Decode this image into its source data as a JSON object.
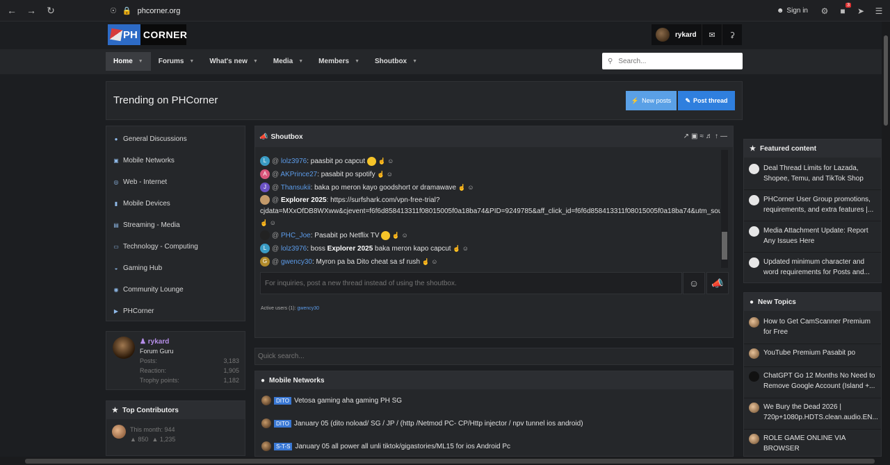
{
  "browser": {
    "url": "phcorner.org",
    "signin_label": "Sign in",
    "ext_badge": "3"
  },
  "header": {
    "logo_ph": "PH",
    "logo_corner": "CORNER",
    "username": "rykard"
  },
  "nav": {
    "items": [
      {
        "label": "Home",
        "active": true
      },
      {
        "label": "Forums"
      },
      {
        "label": "What's new"
      },
      {
        "label": "Media"
      },
      {
        "label": "Members"
      },
      {
        "label": "Shoutbox"
      }
    ],
    "search_placeholder": "Search..."
  },
  "trending": {
    "title": "Trending on PHCorner",
    "new_posts": "New posts",
    "post_thread": "Post thread"
  },
  "categories": [
    {
      "label": "General Discussions",
      "icon": "globe-icon"
    },
    {
      "label": "Mobile Networks",
      "icon": "signal-icon"
    },
    {
      "label": "Web - Internet",
      "icon": "web-icon"
    },
    {
      "label": "Mobile Devices",
      "icon": "phone-icon"
    },
    {
      "label": "Streaming - Media",
      "icon": "film-icon"
    },
    {
      "label": "Technology - Computing",
      "icon": "laptop-icon"
    },
    {
      "label": "Gaming Hub",
      "icon": "gamepad-icon"
    },
    {
      "label": "Community Lounge",
      "icon": "people-icon"
    },
    {
      "label": "PHCorner",
      "icon": "flag-icon"
    }
  ],
  "profile": {
    "name": "rykard",
    "title": "Forum Guru",
    "stats": [
      {
        "label": "Posts:",
        "value": "3,183"
      },
      {
        "label": "Reaction:",
        "value": "1,905"
      },
      {
        "label": "Trophy points:",
        "value": "1,182"
      }
    ]
  },
  "contributors": {
    "title": "Top Contributors",
    "line1": "This month: 944",
    "line2a": "850",
    "line2b": "1,235"
  },
  "shoutbox": {
    "title": "Shoutbox",
    "messages": [
      {
        "avatar": "L",
        "color": "#3a9bc4",
        "user": "lolz3976",
        "text": ": paasbit po capcut",
        "emoji": true
      },
      {
        "avatar": "A",
        "color": "#d9557a",
        "user": "AKPrince27",
        "text": ": pasabit po spotify"
      },
      {
        "avatar": "J",
        "color": "#6a52c4",
        "user": "Thansukii",
        "text": ": baka po meron kayo goodshort or dramawave"
      },
      {
        "avatar": "",
        "color": "#c49a6a",
        "user": "Explorer 2025",
        "bold": true,
        "text": ": https://surfshark.com/vpn-free-trial?cjdata=MXxOfDB8WXww&cjevent=f6f6d858413311f08015005f0a18ba74&PID=9249785&aff_click_id=f6f6d858413311f08015005f0a18ba74&utm_source=cj&utm_medium=5381359"
      },
      {
        "avatar": "",
        "color": "#222",
        "user": "PHC_Joe",
        "text": ": Pasabit po Netflix TV",
        "emoji": true
      },
      {
        "avatar": "L",
        "color": "#3a9bc4",
        "user": "lolz3976",
        "text": ": boss ",
        "mention": "Explorer 2025",
        "text2": " baka meron kapo capcut"
      },
      {
        "avatar": "G",
        "color": "#b08a2a",
        "user": "gwency30",
        "text": ": Myron pa ba Dito cheat sa sf rush"
      }
    ],
    "input_placeholder": "For inquiries, post a new thread instead of using the shoutbox.",
    "active_users": "Active users (1):",
    "active_user_name": "gwency30"
  },
  "quick_search_placeholder": "Quick search...",
  "mobile_networks": {
    "title": "Mobile Networks",
    "threads": [
      {
        "prefix": "DITO",
        "title": "Vetosa gaming aha gaming PH SG"
      },
      {
        "prefix": "DITO",
        "title": "January 05 (dito noload/ SG / JP / (http /Netmod PC- CP/Http injector / npv tunnel ios android)"
      },
      {
        "prefix": "S-T-S",
        "title": "January 05 all power all unli tiktok/gigastories/ML15 for ios Android Pc"
      }
    ]
  },
  "featured": {
    "title": "Featured content",
    "items": [
      "Deal Thread Limits for Lazada, Shopee, Temu, and TikTok Shop",
      "PHCorner User Group promotions, requirements, and extra features |...",
      "Media Attachment Update: Report Any Issues Here",
      "Updated minimum character and word requirements for Posts and..."
    ]
  },
  "new_topics": {
    "title": "New Topics",
    "items": [
      "How to Get CamScanner Premium for Free",
      "YouTube Premium Pasabit po",
      "ChatGPT Go 12 Months No Need to Remove Google Account (Island +...",
      "We Bury the Dead 2026 | 720p+1080p.HDTS.clean.audio.EN...",
      "ROLE GAME ONLINE VIA BROWSER"
    ]
  },
  "colors": {
    "accent_blue": "#2f7fde",
    "username_purple": "#b58ee8",
    "link_blue": "#5c9be8"
  }
}
